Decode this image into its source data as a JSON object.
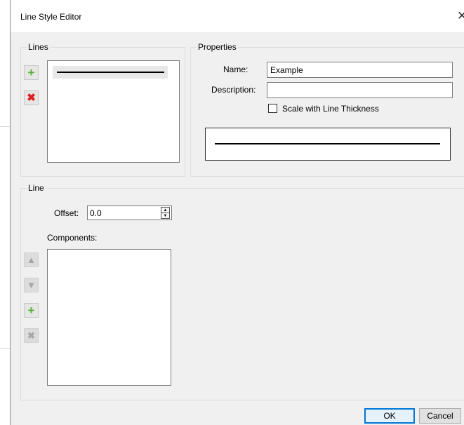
{
  "window": {
    "title": "Line Style Editor",
    "close_glyph": "✕"
  },
  "lines_group": {
    "legend": "Lines",
    "add_button_glyph": "+",
    "remove_button_glyph": "✖"
  },
  "properties_group": {
    "legend": "Properties",
    "name_label": "Name:",
    "name_value": "Example",
    "description_label": "Description:",
    "description_value": "",
    "scale_checkbox_label": "Scale with Line Thickness",
    "scale_checked": false
  },
  "line_group": {
    "legend": "Line",
    "offset_label": "Offset:",
    "offset_value": "0.0",
    "components_label": "Components:",
    "move_up_glyph": "▲",
    "move_down_glyph": "▼",
    "add_glyph": "+",
    "remove_glyph": "✖"
  },
  "buttons": {
    "ok": "OK",
    "cancel": "Cancel"
  },
  "colors": {
    "add_green": "#54b231",
    "remove_red": "#e01f1f",
    "disabled_gray": "#a6a6a6",
    "default_button_border": "#0078d7"
  }
}
